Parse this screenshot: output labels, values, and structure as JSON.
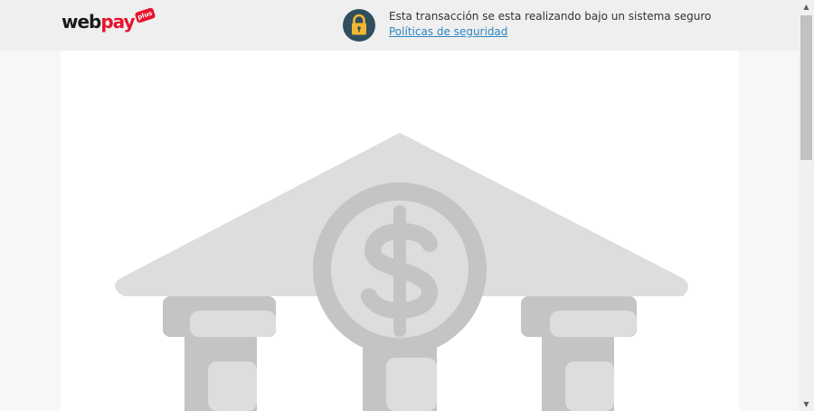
{
  "header": {
    "logo": {
      "web": "web",
      "pay": "pay",
      "plus": "plus"
    },
    "security_text": "Esta transacción se esta realizando bajo un sistema seguro ",
    "security_link": "Políticas de seguridad",
    "lock_icon": "padlock-icon"
  },
  "illustration": {
    "icon": "bank-dollar-icon",
    "colors": {
      "roof": "#dddddd",
      "column": "#c4c5c2",
      "coin_ring": "#c4c5c2",
      "coin_face": "#dddddd"
    }
  },
  "scrollbar": {
    "up_arrow": "▲",
    "down_arrow": "▼"
  },
  "colors": {
    "brand_red": "#e8122d",
    "lock_bg": "#2f4f5f",
    "lock_yellow": "#f5b631",
    "link": "#2e86c1"
  }
}
